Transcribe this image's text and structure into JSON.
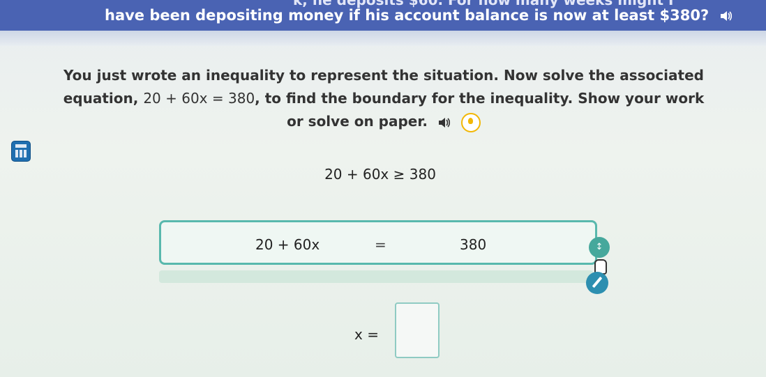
{
  "question": {
    "line1": "k, he deposits $60. For how many weeks might I",
    "line2": "have been depositing money if his account balance is now at least $380?"
  },
  "instruction": {
    "text_before_eq": "You just wrote an inequality to represent the situation. Now solve the associated equation, ",
    "equation": "20 + 60x = 380",
    "text_after_eq": ", to find the boundary for the inequality. Show your work or solve on paper."
  },
  "inequality": "20 + 60x ≥ 380",
  "equation_row": {
    "left": "20 + 60x",
    "sign": "=",
    "right": "380"
  },
  "answer": {
    "label": "x =",
    "value": ""
  },
  "icons": [
    "speaker-icon",
    "hint-lightbulb-icon",
    "calculator-icon",
    "move-handle-icon",
    "pencil-icon"
  ],
  "colors": {
    "banner": "#4a63b3",
    "teal_border": "#58b8ad",
    "hint_yellow": "#f2b705",
    "calc_blue": "#1f6fb0"
  }
}
